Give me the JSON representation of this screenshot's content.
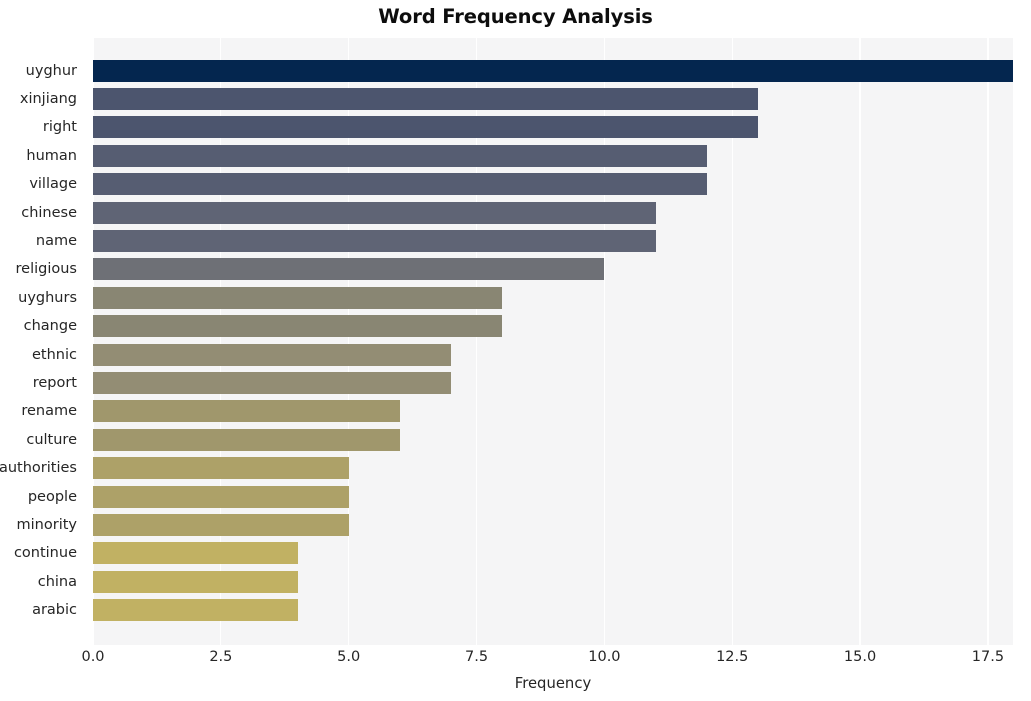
{
  "chart_data": {
    "type": "bar",
    "orientation": "horizontal",
    "title": "Word Frequency Analysis",
    "xlabel": "Frequency",
    "ylabel": "",
    "xlim": [
      0,
      17.99
    ],
    "xticks": [
      "0.0",
      "2.5",
      "5.0",
      "7.5",
      "10.0",
      "12.5",
      "15.0",
      "17.5"
    ],
    "xtick_values": [
      0,
      2.5,
      5,
      7.5,
      10,
      12.5,
      15,
      17.5
    ],
    "grid": "vertical-white-on-gray",
    "legend": "none",
    "categories": [
      "uyghur",
      "xinjiang",
      "right",
      "human",
      "village",
      "chinese",
      "name",
      "religious",
      "uyghurs",
      "change",
      "ethnic",
      "report",
      "rename",
      "culture",
      "authorities",
      "people",
      "minority",
      "continue",
      "china",
      "arabic"
    ],
    "values": [
      18,
      13,
      13,
      12,
      12,
      11,
      11,
      10,
      8,
      8,
      7,
      7,
      6,
      6,
      5,
      5,
      5,
      4,
      4,
      4
    ],
    "bar_colors": [
      "#04264f",
      "#4c556e",
      "#4c556e",
      "#565d72",
      "#565d72",
      "#5f6475",
      "#5f6475",
      "#6e7076",
      "#898673",
      "#898673",
      "#938d74",
      "#938d74",
      "#a0976c",
      "#a0976c",
      "#ada168",
      "#ada168",
      "#ada168",
      "#c1b163",
      "#c1b163",
      "#c1b163"
    ],
    "plot_background": "#f5f5f6",
    "figure_background": "#ffffff",
    "gridline_color": "#ffffff",
    "text_color": "#262626",
    "title_color": "#0d0d0d"
  }
}
